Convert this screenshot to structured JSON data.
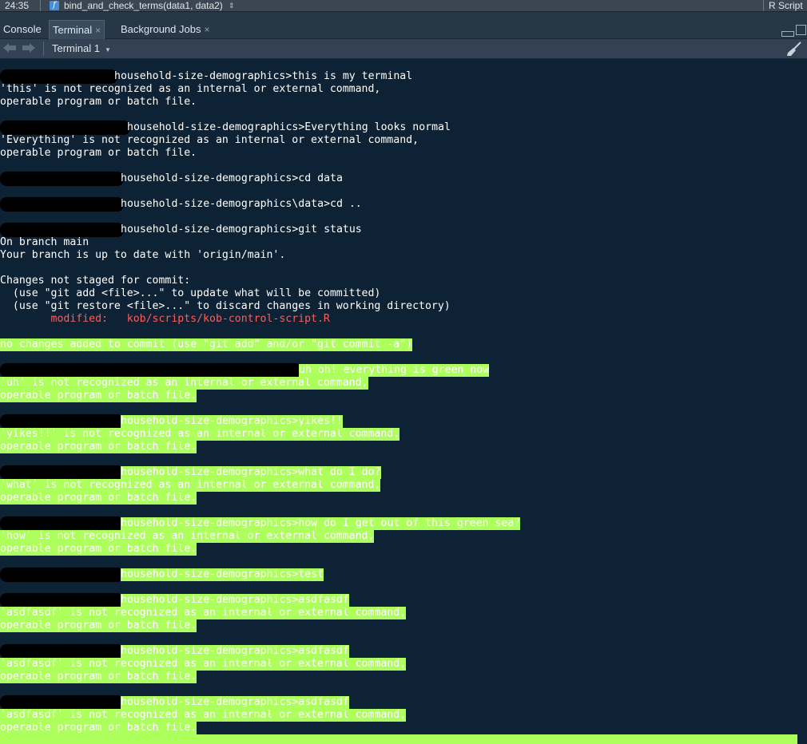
{
  "status_bar": {
    "position": "24:35",
    "function_icon": "f",
    "function_name": "bind_and_check_terms(data1, data2)",
    "nav_glyph": "⇕",
    "file_type": "R Script"
  },
  "tabs": [
    {
      "label": "Console",
      "active": false
    },
    {
      "label": "Terminal",
      "active": true,
      "close": "×"
    },
    {
      "label": "Background Jobs",
      "active": false,
      "close": "×"
    }
  ],
  "toolbar": {
    "terminal_selector": "Terminal 1",
    "back_icon": "back-arrow-icon",
    "forward_icon": "forward-arrow-icon",
    "clear_icon": "broom-icon"
  },
  "colors": {
    "terminal_bg": "#0e2235",
    "highlight": "#adff5c",
    "modified": "#ff5c5c"
  },
  "terminal": {
    "lines": [
      {
        "text": "household-size-demographics>this is my terminal",
        "indent": 18
      },
      {
        "text": "'this' is not recognized as an internal or external command,"
      },
      {
        "text": "operable program or batch file."
      },
      {
        "text": ""
      },
      {
        "text": "household-size-demographics>Everything looks normal",
        "indent": 20
      },
      {
        "text": "'Everything' is not recognized as an internal or external command,"
      },
      {
        "text": "operable program or batch file."
      },
      {
        "text": ""
      },
      {
        "text": "household-size-demographics>cd data",
        "indent": 19
      },
      {
        "text": ""
      },
      {
        "text": "household-size-demographics\\data>cd ..",
        "indent": 19
      },
      {
        "text": ""
      },
      {
        "text": "household-size-demographics>git status",
        "indent": 19
      },
      {
        "text": "On branch main"
      },
      {
        "text": "Your branch is up to date with 'origin/main'."
      },
      {
        "text": ""
      },
      {
        "text": "Changes not staged for commit:"
      },
      {
        "text": "  (use \"git add <file>...\" to update what will be committed)"
      },
      {
        "text": "  (use \"git restore <file>...\" to discard changes in working directory)"
      },
      {
        "text": "        modified:   kob/scripts/kob-control-script.R",
        "style": "mod"
      },
      {
        "text": ""
      },
      {
        "text": "no changes added to commit (use \"git add\" and/or \"git commit -a\")",
        "style": "hl"
      },
      {
        "text": ""
      },
      {
        "text": "uh oh! everything is green now",
        "indent": 47,
        "style": "hl"
      },
      {
        "text": "'uh' is not recognized as an internal or external command,",
        "style": "hl"
      },
      {
        "text": "operable program or batch file.",
        "style": "hl"
      },
      {
        "text": ""
      },
      {
        "text": "household-size-demographics>yikes!!",
        "indent": 19,
        "style": "hl"
      },
      {
        "text": "'yikes!!' is not recognized as an internal or external command,",
        "style": "hl"
      },
      {
        "text": "operable program or batch file.",
        "style": "hl"
      },
      {
        "text": ""
      },
      {
        "text": "household-size-demographics>what do I do?",
        "indent": 19,
        "style": "hl"
      },
      {
        "text": "'what' is not recognized as an internal or external command,",
        "style": "hl"
      },
      {
        "text": "operable program or batch file.",
        "style": "hl"
      },
      {
        "text": ""
      },
      {
        "text": "household-size-demographics>how do I get out of this green sea?",
        "indent": 19,
        "style": "hl"
      },
      {
        "text": "'how' is not recognized as an internal or external command,",
        "style": "hl"
      },
      {
        "text": "operable program or batch file.",
        "style": "hl"
      },
      {
        "text": ""
      },
      {
        "text": "household-size-demographics>test",
        "indent": 19,
        "style": "hl"
      },
      {
        "text": ""
      },
      {
        "text": "household-size-demographics>asdfasdf",
        "indent": 19,
        "style": "hl"
      },
      {
        "text": "'asdfasdf' is not recognized as an internal or external command,",
        "style": "hl"
      },
      {
        "text": "operable program or batch file.",
        "style": "hl"
      },
      {
        "text": ""
      },
      {
        "text": "household-size-demographics>asdfasdf",
        "indent": 19,
        "style": "hl"
      },
      {
        "text": "'asdfasdf' is not recognized as an internal or external command,",
        "style": "hl"
      },
      {
        "text": "operable program or batch file.",
        "style": "hl"
      },
      {
        "text": ""
      },
      {
        "text": "household-size-demographics>asdfasdf",
        "indent": 19,
        "style": "hl"
      },
      {
        "text": "'asdfasdf' is not recognized as an internal or external command,",
        "style": "hl"
      },
      {
        "text": "operable program or batch file.",
        "style": "hl"
      }
    ]
  }
}
